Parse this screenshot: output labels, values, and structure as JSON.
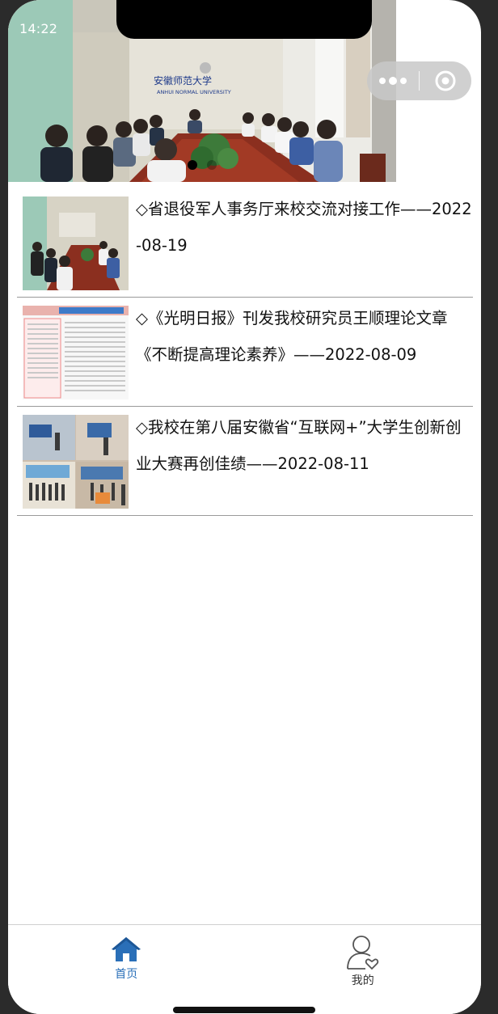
{
  "status_bar": {
    "time": "14:22"
  },
  "banner": {
    "slides": 2,
    "active_index": 0,
    "school_name_cn": "安徽师范大学",
    "school_name_en": "ANHUI NORMAL UNIVERSITY"
  },
  "capsule": {
    "more_icon": "more-dots-icon",
    "close_icon": "target-circle-icon"
  },
  "news": [
    {
      "title": "◇省退役军人事务厅来校交流对接工作——2022-08-19",
      "thumb": "meeting-photo"
    },
    {
      "title": "◇《光明日报》刊发我校研究员王顺理论文章《不断提高理论素养》——2022-08-09",
      "thumb": "newspaper-clipping"
    },
    {
      "title": "◇我校在第八届安徽省“互联网+”大学生创新创业大赛再创佳绩——2022-08-11",
      "thumb": "event-collage"
    }
  ],
  "tabbar": {
    "items": [
      {
        "label": "首页",
        "icon": "home-icon",
        "active": true
      },
      {
        "label": "我的",
        "icon": "user-heart-icon",
        "active": false
      }
    ],
    "active_color": "#2a6fb8"
  }
}
